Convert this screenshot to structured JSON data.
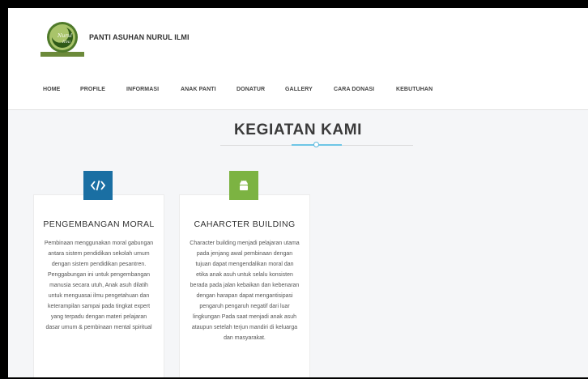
{
  "header": {
    "site_name": "PANTI ASUHAN NURUL ILMI",
    "logo_text": "Nurul Ilmi"
  },
  "nav": {
    "items": [
      {
        "label": "HOME"
      },
      {
        "label": "PROFILE"
      },
      {
        "label": "INFORMASI"
      },
      {
        "label": "ANAK PANTI"
      },
      {
        "label": "DONATUR"
      },
      {
        "label": "GALLERY"
      },
      {
        "label": "CARA DONASI"
      },
      {
        "label": "KEBUTUHAN"
      }
    ]
  },
  "section": {
    "title": "KEGIATAN KAMI"
  },
  "cards": [
    {
      "icon": "code-icon",
      "icon_color": "#1a6fa3",
      "title": "PENGEMBANGAN MORAL",
      "body": "Pembinaan menggunakan moral gabungan antara sistem pendidikan sekolah umum dengan sistem pendidikan pesantren. Penggabungan ini untuk pengembangan manusia secara utuh, Anak asuh dilatih untuk menguasai ilmu pengetahuan dan keterampilan sampai pada tingkat expert yang terpadu dengan materi pelajaran dasar umum & pembinaan mental spiritual"
    },
    {
      "icon": "android-icon",
      "icon_color": "#7cb342",
      "title": "CAHARCTER BUILDING",
      "body": "Character building menjadi pelajaran utama pada jenjang awal pembinaan dengan tujuan dapat mengendalikan moral dan etika anak asuh untuk selalu konsisten berada pada jalan kebaikan dan kebenaran dengan harapan dapat mengantisipasi pengaruh pengaruh negatif dari luar lingkungan Pada saat menjadi anak asuh ataupun setelah terjun mandiri di keluarga dan masyarakat."
    }
  ]
}
